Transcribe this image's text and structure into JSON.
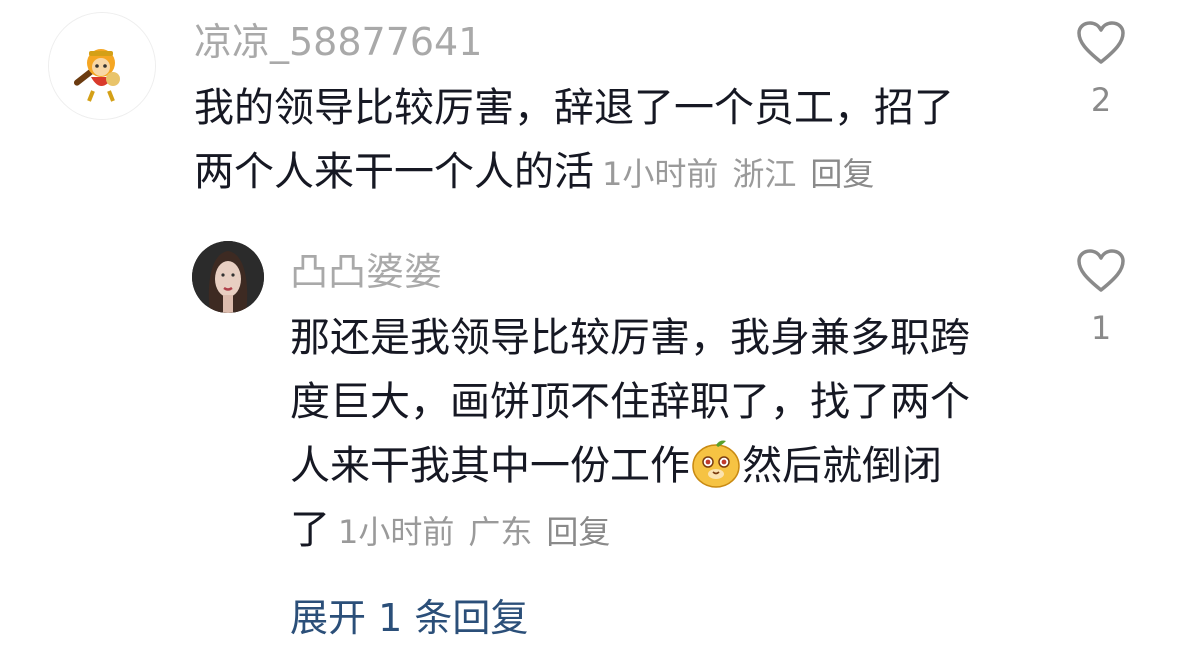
{
  "colors": {
    "username": "#a9a9a9",
    "text": "#161823",
    "meta": "#9a9a9a",
    "link": "#2b4f79",
    "icon": "#8a8a8a"
  },
  "comments": [
    {
      "username": "凉凉_58877641",
      "avatar_icon": "monkey-king-avatar",
      "lines": [
        "我的领导比较厉害，辞退了一个员工，招了",
        "两个人来干一个人的活"
      ],
      "time": "1小时前",
      "location": "浙江",
      "reply_label": "回复",
      "likes": "2"
    }
  ],
  "reply": {
    "username": "凸凸婆婆",
    "avatar_icon": "woman-portrait-avatar",
    "lines": [
      "那还是我领导比较厉害，我身兼多职跨",
      "度巨大，画饼顶不住辞职了，找了两个"
    ],
    "line3_before_emoji": "人来干我其中一份工作",
    "emoji_name": "smiling-emoji-icon",
    "line3_after_emoji": "然后就倒闭",
    "line4": "了",
    "time": "1小时前",
    "location": "广东",
    "reply_label": "回复",
    "likes": "1"
  },
  "expand_label": "展开 1 条回复"
}
